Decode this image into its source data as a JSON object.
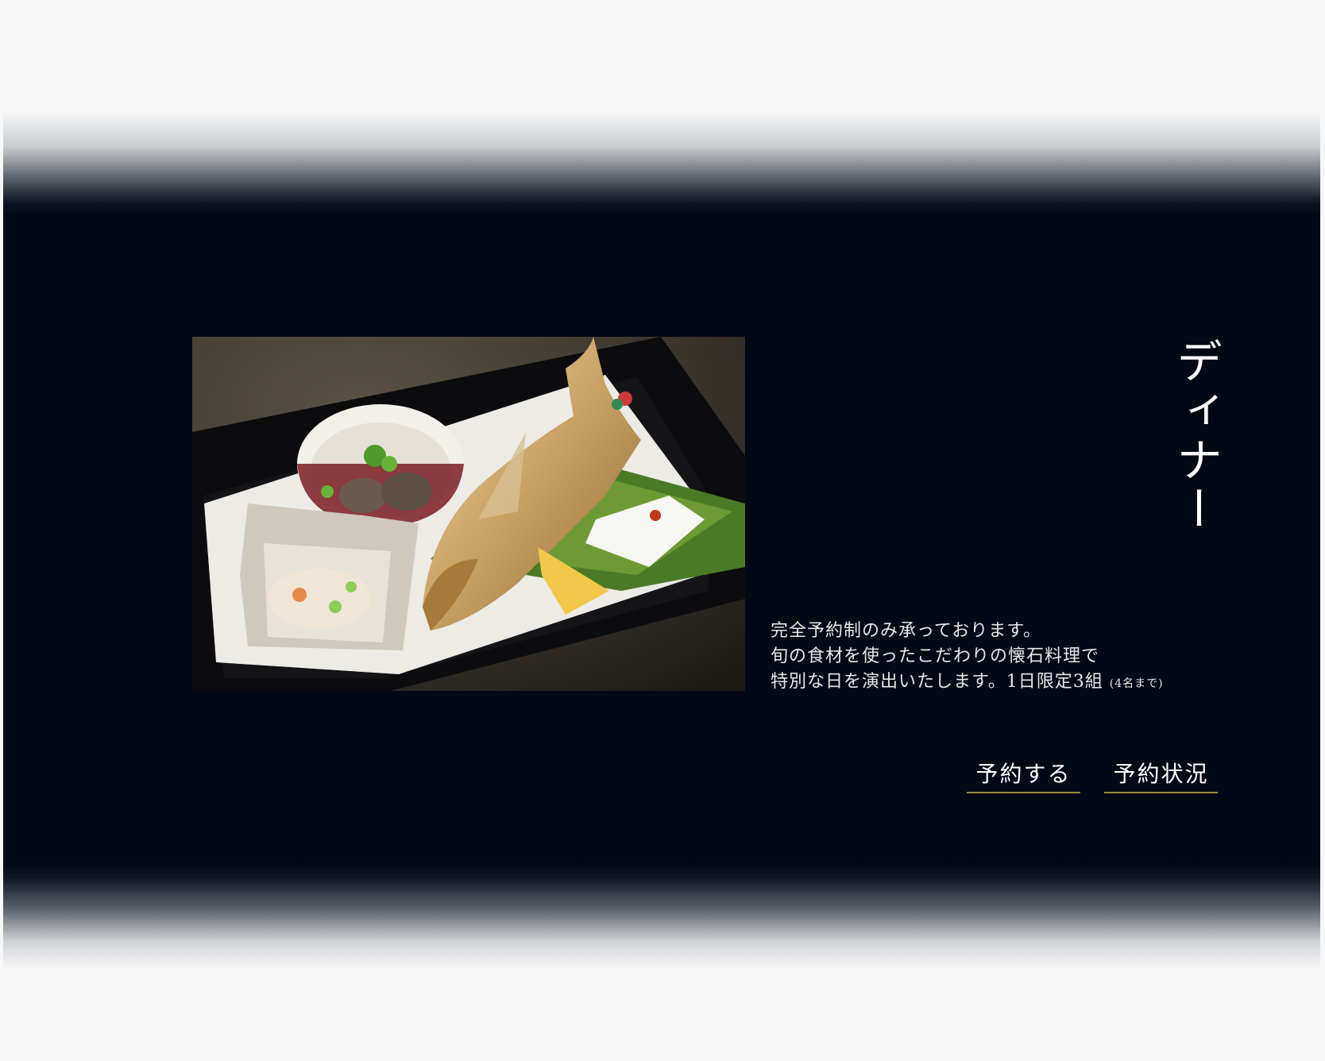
{
  "section": {
    "title": "ディナー",
    "description": {
      "line1": "完全予約制のみ承っております。",
      "line2": "旬の食材を使ったこだわりの懐石料理で",
      "line3": "特別な日を演出いたします。1日限定3組",
      "note": "(4名まで)"
    },
    "photo": "dinner-kaiseki-photo"
  },
  "actions": {
    "reserve_label": "予約する",
    "status_label": "予約状況"
  },
  "colors": {
    "band": "#020814",
    "page": "#f7f7f7",
    "underline": "#9a8a3a"
  }
}
